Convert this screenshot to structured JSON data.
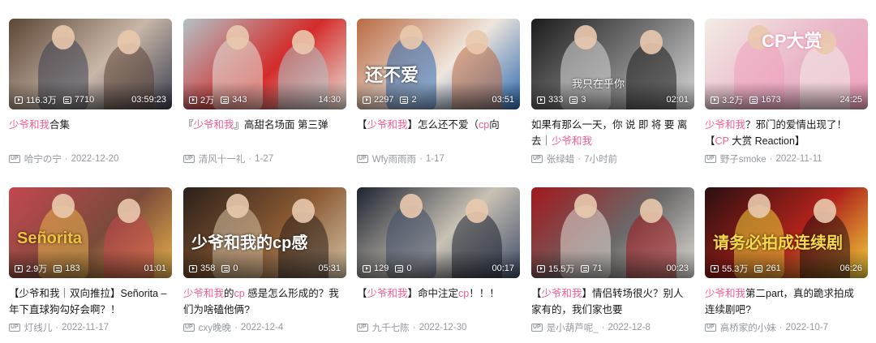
{
  "cards": [
    {
      "views": "116.3万",
      "danmaku": "7710",
      "duration": "03:59:23",
      "title": [
        {
          "t": "少爷和我",
          "hl": true
        },
        {
          "t": "合集",
          "hl": false
        }
      ],
      "uploader": "哈宁の宁",
      "date": "2022-12-20",
      "overlay": "",
      "colors": [
        "#5c4636",
        "#c9b7a8",
        "#3b3f52"
      ]
    },
    {
      "views": "2万",
      "danmaku": "343",
      "duration": "14:30",
      "title": [
        {
          "t": "『",
          "hl": false
        },
        {
          "t": "少爷和我",
          "hl": true
        },
        {
          "t": "』高甜名场面 第三弹",
          "hl": false
        }
      ],
      "uploader": "清风十一礼",
      "date": "1-27",
      "overlay": "",
      "colors": [
        "#b3c2c6",
        "#d42b2a",
        "#e8e2d8"
      ]
    },
    {
      "views": "2297",
      "danmaku": "2",
      "duration": "03:51",
      "title": [
        {
          "t": "【",
          "hl": false
        },
        {
          "t": "少爷和我",
          "hl": true
        },
        {
          "t": "】怎么还不爱（",
          "hl": false
        },
        {
          "t": "cp",
          "hl": true
        },
        {
          "t": "向",
          "hl": false
        }
      ],
      "uploader": "Wfy雨雨雨",
      "date": "1-17",
      "overlay": "还不爱",
      "colors": [
        "#b96a43",
        "#f0e6dd",
        "#2d6ab0"
      ]
    },
    {
      "views": "333",
      "danmaku": "3",
      "duration": "02:01",
      "title": [
        {
          "t": "如果有那么一天，你 说 即 将 要 离 去｜",
          "hl": false
        },
        {
          "t": "少爷和我",
          "hl": true
        }
      ],
      "uploader": "张绿蜡",
      "date": "7小时前",
      "overlay": "我只在乎你",
      "colors": [
        "#1b1b1b",
        "#7d7d7d",
        "#d9d9d9"
      ]
    },
    {
      "views": "3.2万",
      "danmaku": "1673",
      "duration": "24:25",
      "title": [
        {
          "t": "少爷和我",
          "hl": true
        },
        {
          "t": "？邪门的爱情出现了！【",
          "hl": false
        },
        {
          "t": "CP",
          "hl": true
        },
        {
          "t": " 大赏 Reaction】",
          "hl": false
        }
      ],
      "uploader": "野子smoke",
      "date": "2022-11-11",
      "overlay": "CP大赏",
      "colors": [
        "#f3ede5",
        "#e9b6c9",
        "#f0a1bd"
      ]
    },
    {
      "views": "2.9万",
      "danmaku": "183",
      "duration": "01:01",
      "title": [
        {
          "t": "【少爷和我｜双向推拉】Señorita – 年下直球狗勾好会啊？！",
          "hl": false
        }
      ],
      "uploader": "灯线儿",
      "date": "2022-11-17",
      "overlay": "Señorita",
      "colors": [
        "#c4474f",
        "#7a4a3a",
        "#e7b24c"
      ]
    },
    {
      "views": "358",
      "danmaku": "0",
      "duration": "05:31",
      "title": [
        {
          "t": "少爷和我",
          "hl": true
        },
        {
          "t": "的",
          "hl": false
        },
        {
          "t": "cp",
          "hl": true
        },
        {
          "t": " 感是怎么形成的？我们为啥磕他俩?",
          "hl": false
        }
      ],
      "uploader": "cxy晚晚",
      "date": "2022-12-4",
      "overlay": "少爷和我的cp感",
      "colors": [
        "#2b1f1a",
        "#8a5a33",
        "#d6c3a4"
      ]
    },
    {
      "views": "129",
      "danmaku": "0",
      "duration": "00:17",
      "title": [
        {
          "t": "【",
          "hl": false
        },
        {
          "t": "少爷和我",
          "hl": true
        },
        {
          "t": "】命中注定",
          "hl": false
        },
        {
          "t": "cp",
          "hl": true
        },
        {
          "t": "！！！",
          "hl": false
        }
      ],
      "uploader": "九千七陈",
      "date": "2022-12-30",
      "overlay": "",
      "colors": [
        "#1d2330",
        "#c9c2b5",
        "#3f4c68"
      ]
    },
    {
      "views": "15.5万",
      "danmaku": "71",
      "duration": "00:23",
      "title": [
        {
          "t": "【",
          "hl": false
        },
        {
          "t": "少爷和我",
          "hl": true
        },
        {
          "t": "】情侣转场很火？别人家有的，我们家也要",
          "hl": false
        }
      ],
      "uploader": "是小葫芦呢_",
      "date": "2022-12-8",
      "overlay": "",
      "colors": [
        "#a1181d",
        "#6b6a6a",
        "#e1ddd6"
      ]
    },
    {
      "views": "55.3万",
      "danmaku": "261",
      "duration": "06:26",
      "title": [
        {
          "t": "少爷和我",
          "hl": true
        },
        {
          "t": "第二part，真的跪求拍成连续剧吧?",
          "hl": false
        }
      ],
      "uploader": "高桥家的小妹",
      "date": "2022-10-7",
      "overlay": "请务必拍成连续剧",
      "colors": [
        "#2a0f10",
        "#b0221b",
        "#f2d33b"
      ]
    }
  ]
}
